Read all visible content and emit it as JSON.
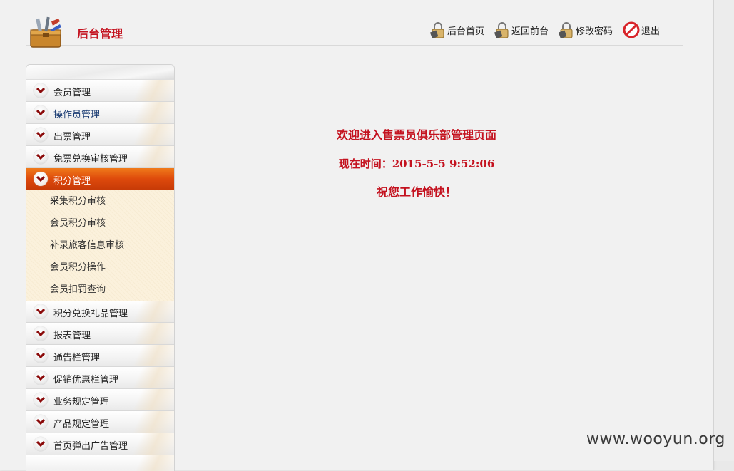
{
  "header": {
    "title": "后台管理",
    "logo_icon": "toolbox-icon",
    "nav": [
      {
        "label": "后台首页",
        "icon": "lock-icon"
      },
      {
        "label": "返回前台",
        "icon": "lock-icon"
      },
      {
        "label": "修改密码",
        "icon": "lock-icon"
      },
      {
        "label": "退出",
        "icon": "no-entry-icon"
      }
    ]
  },
  "sidebar": {
    "items": [
      {
        "label": "会员管理"
      },
      {
        "label": "操作员管理"
      },
      {
        "label": "出票管理"
      },
      {
        "label": "免票兑换审核管理"
      },
      {
        "label": "积分管理"
      },
      {
        "label": "积分兑换礼品管理"
      },
      {
        "label": "报表管理"
      },
      {
        "label": "通告栏管理"
      },
      {
        "label": "促销优惠栏管理"
      },
      {
        "label": "业务规定管理"
      },
      {
        "label": "产品规定管理"
      },
      {
        "label": "首页弹出广告管理"
      }
    ],
    "active_index": 4,
    "subitems": [
      {
        "label": "采集积分审核"
      },
      {
        "label": "会员积分审核"
      },
      {
        "label": "补录旅客信息审核"
      },
      {
        "label": "会员积分操作"
      },
      {
        "label": "会员扣罚查询"
      }
    ]
  },
  "main": {
    "welcome": "欢迎进入售票员俱乐部管理页面",
    "time": "现在时间：2015-5-5 9:52:06",
    "wish": "祝您工作愉快！"
  },
  "watermark": "www.wooyun.org",
  "colors": {
    "title_red": "#c4121f",
    "active_orange": "#de4a0c",
    "submenu_bg": "#fbf1dc"
  }
}
